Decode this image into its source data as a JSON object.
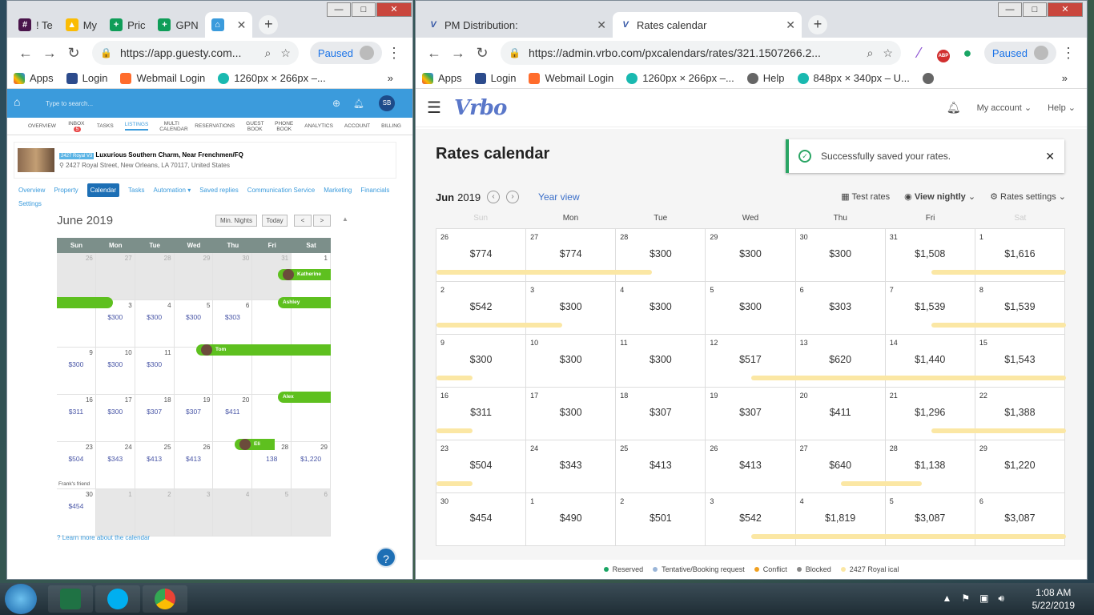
{
  "left": {
    "tabs": [
      "! Te",
      "My",
      "Pric",
      "GPN",
      ""
    ],
    "url": "https://app.guesty.com...",
    "paused": "Paused",
    "bookmarks": [
      "Apps",
      "Login",
      "Webmail Login",
      "1260px × 266px –..."
    ],
    "search_placeholder": "Type to search...",
    "avatar": "SB",
    "nav": [
      "OVERVIEW",
      "INBOX",
      "TASKS",
      "LISTINGS",
      "MULTI CALENDAR",
      "RESERVATIONS",
      "GUEST BOOK",
      "PHONE BOOK",
      "ANALYTICS",
      "ACCOUNT",
      "BILLING"
    ],
    "inbox_badge": "5",
    "listing_tag": "2427 Royal V3",
    "listing_title": "Luxurious Southern Charm, Near Frenchmen/FQ",
    "listing_address": "2427 Royal Street, New Orleans, LA 70117, United States",
    "subtabs": [
      "Overview",
      "Property",
      "Calendar",
      "Tasks",
      "Automation",
      "Saved replies",
      "Communication Service",
      "Marketing",
      "Financials",
      "Settings"
    ],
    "month": "June 2019",
    "min_nights": "Min. Nights",
    "today": "Today",
    "prev": "<",
    "next": ">",
    "days": [
      "Sun",
      "Mon",
      "Tue",
      "Wed",
      "Thu",
      "Fri",
      "Sat"
    ],
    "weeks": [
      [
        {
          "d": "26",
          "o": 1
        },
        {
          "d": "27",
          "o": 1
        },
        {
          "d": "28",
          "o": 1
        },
        {
          "d": "29",
          "o": 1
        },
        {
          "d": "30",
          "o": 1
        },
        {
          "d": "31",
          "o": 1
        },
        {
          "d": "1"
        }
      ],
      [
        {
          "d": "2"
        },
        {
          "d": "3",
          "p": "$300"
        },
        {
          "d": "4",
          "p": "$300"
        },
        {
          "d": "5",
          "p": "$300"
        },
        {
          "d": "6",
          "p": "$303"
        },
        {
          "d": "7"
        },
        {
          "d": "8"
        }
      ],
      [
        {
          "d": "9",
          "p": "$300"
        },
        {
          "d": "10",
          "p": "$300"
        },
        {
          "d": "11",
          "p": "$300"
        },
        {
          "d": "12"
        },
        {
          "d": "13"
        },
        {
          "d": "14"
        },
        {
          "d": "15"
        }
      ],
      [
        {
          "d": "16",
          "p": "$311"
        },
        {
          "d": "17",
          "p": "$300"
        },
        {
          "d": "18",
          "p": "$307"
        },
        {
          "d": "19",
          "p": "$307"
        },
        {
          "d": "20",
          "p": "$411"
        },
        {
          "d": "21"
        },
        {
          "d": "22"
        }
      ],
      [
        {
          "d": "23",
          "p": "$504",
          "n": "Frank's friend"
        },
        {
          "d": "24",
          "p": "$343"
        },
        {
          "d": "25",
          "p": "$413"
        },
        {
          "d": "26",
          "p": "$413"
        },
        {
          "d": "27"
        },
        {
          "d": "28",
          "p": "138"
        },
        {
          "d": "29",
          "p": "$1,220"
        }
      ],
      [
        {
          "d": "30",
          "p": "$454"
        },
        {
          "d": "1",
          "o": 1
        },
        {
          "d": "2",
          "o": 1
        },
        {
          "d": "3",
          "o": 1
        },
        {
          "d": "4",
          "o": 1
        },
        {
          "d": "5",
          "o": 1
        },
        {
          "d": "6",
          "o": 1
        }
      ]
    ],
    "guests": [
      "Katherine",
      "Ashley",
      "Tom",
      "Alex",
      "Eli"
    ],
    "learn_more": "Learn more about the calendar",
    "help": "?"
  },
  "right": {
    "tabs": [
      "PM Distribution:",
      "Rates calendar"
    ],
    "url": "https://admin.vrbo.com/pxcalendars/rates/321.1507266.2...",
    "paused": "Paused",
    "bookmarks": [
      "Apps",
      "Login",
      "Webmail Login",
      "1260px × 266px –...",
      "Help",
      "848px × 340px – U..."
    ],
    "logo": "Vrbo",
    "my_account": "My account",
    "help": "Help",
    "title": "Rates calendar",
    "toast": "Successfully saved your rates.",
    "month": "Jun",
    "year": "2019",
    "year_view": "Year view",
    "test_rates": "Test rates",
    "view_nightly": "View nightly",
    "rates_settings": "Rates settings",
    "days": [
      "Sun",
      "Mon",
      "Tue",
      "Wed",
      "Thu",
      "Fri",
      "Sat"
    ],
    "weeks": [
      [
        [
          "26",
          "$774"
        ],
        [
          "27",
          "$774"
        ],
        [
          "28",
          "$300"
        ],
        [
          "29",
          "$300"
        ],
        [
          "30",
          "$300"
        ],
        [
          "31",
          "$1,508"
        ],
        [
          "1",
          "$1,616"
        ]
      ],
      [
        [
          "2",
          "$542"
        ],
        [
          "3",
          "$300"
        ],
        [
          "4",
          "$300"
        ],
        [
          "5",
          "$300"
        ],
        [
          "6",
          "$303"
        ],
        [
          "7",
          "$1,539"
        ],
        [
          "8",
          "$1,539"
        ]
      ],
      [
        [
          "9",
          "$300"
        ],
        [
          "10",
          "$300"
        ],
        [
          "11",
          "$300"
        ],
        [
          "12",
          "$517"
        ],
        [
          "13",
          "$620"
        ],
        [
          "14",
          "$1,440"
        ],
        [
          "15",
          "$1,543"
        ]
      ],
      [
        [
          "16",
          "$311"
        ],
        [
          "17",
          "$300"
        ],
        [
          "18",
          "$307"
        ],
        [
          "19",
          "$307"
        ],
        [
          "20",
          "$411"
        ],
        [
          "21",
          "$1,296"
        ],
        [
          "22",
          "$1,388"
        ]
      ],
      [
        [
          "23",
          "$504"
        ],
        [
          "24",
          "$343"
        ],
        [
          "25",
          "$413"
        ],
        [
          "26",
          "$413"
        ],
        [
          "27",
          "$640"
        ],
        [
          "28",
          "$1,138"
        ],
        [
          "29",
          "$1,220"
        ]
      ],
      [
        [
          "30",
          "$454"
        ],
        [
          "1",
          "$490"
        ],
        [
          "2",
          "$501"
        ],
        [
          "3",
          "$542"
        ],
        [
          "4",
          "$1,819"
        ],
        [
          "5",
          "$3,087"
        ],
        [
          "6",
          "$3,087"
        ]
      ]
    ],
    "legend": [
      {
        "label": "Reserved",
        "color": "#1aa564"
      },
      {
        "label": "Tentative/Booking request",
        "color": "#9ab5d8"
      },
      {
        "label": "Conflict",
        "color": "#f0a020"
      },
      {
        "label": "Blocked",
        "color": "#888888"
      },
      {
        "label": "2427 Royal ical",
        "color": "#fbe7a4"
      }
    ]
  },
  "taskbar": {
    "time": "1:08 AM",
    "date": "5/22/2019"
  }
}
